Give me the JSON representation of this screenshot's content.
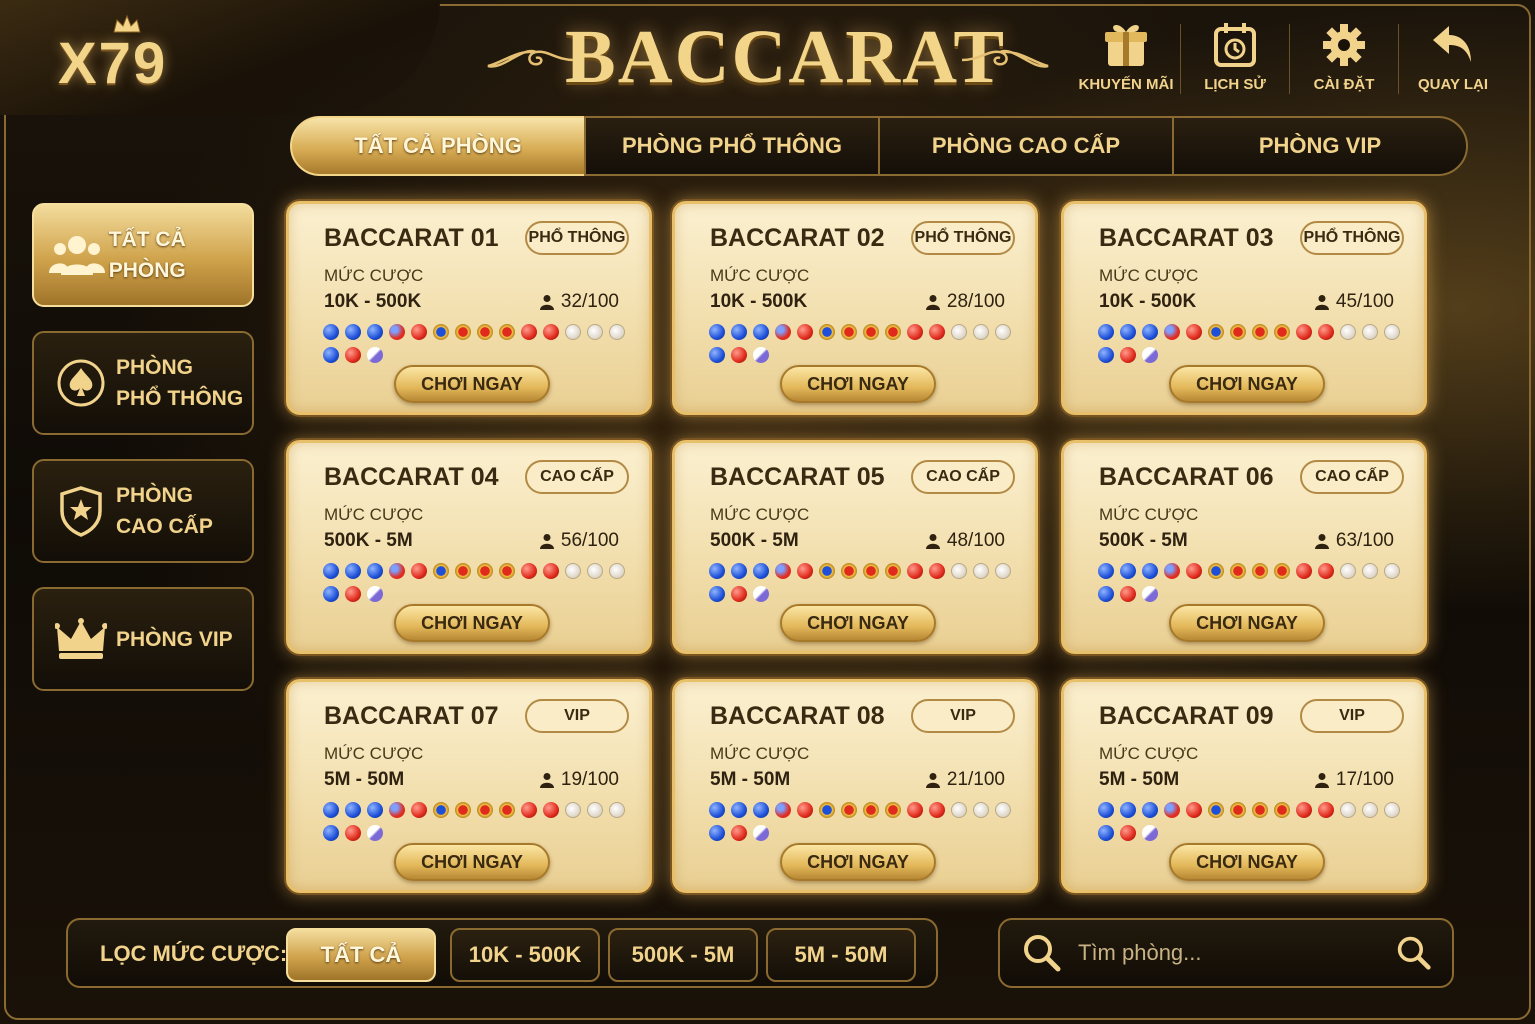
{
  "header": {
    "logo": "X79",
    "title": "BACCARAT",
    "actions": [
      {
        "label": "KHUYẾN MÃI",
        "icon": "gift-icon"
      },
      {
        "label": "LỊCH SỬ",
        "icon": "calendar-history-icon"
      },
      {
        "label": "CÀI ĐẶT",
        "icon": "gear-icon"
      },
      {
        "label": "QUAY LẠI",
        "icon": "back-arrow-icon"
      }
    ]
  },
  "tabs": [
    {
      "label": "TẤT CẢ PHÒNG",
      "active": true
    },
    {
      "label": "PHÒNG PHỔ THÔNG",
      "active": false
    },
    {
      "label": "PHÒNG CAO CẤP",
      "active": false
    },
    {
      "label": "PHÒNG VIP",
      "active": false
    }
  ],
  "sidebar": {
    "items": [
      {
        "label": "TẤT CẢ PHÒNG",
        "icon": "users-group-icon",
        "active": true
      },
      {
        "label_line1": "PHÒNG",
        "label_line2": "PHỔ THÔNG",
        "icon": "spade-icon",
        "active": false
      },
      {
        "label_line1": "PHÒNG",
        "label_line2": "CAO CẤP",
        "icon": "shield-star-icon",
        "active": false
      },
      {
        "label": "PHÒNG VIP",
        "icon": "crown-icon",
        "active": false
      }
    ]
  },
  "rooms": {
    "bet_label": "MỨC CƯỢC",
    "play_label": "CHƠI NGAY",
    "list": [
      {
        "name": "BACCARAT 01",
        "tier": "PHỔ THÔNG",
        "range": "10K - 500K",
        "players": "32/100"
      },
      {
        "name": "BACCARAT 02",
        "tier": "PHỔ THÔNG",
        "range": "10K - 500K",
        "players": "28/100"
      },
      {
        "name": "BACCARAT 03",
        "tier": "PHỔ THÔNG",
        "range": "10K - 500K",
        "players": "45/100"
      },
      {
        "name": "BACCARAT 04",
        "tier": "CAO CẤP",
        "range": "500K - 5M",
        "players": "56/100"
      },
      {
        "name": "BACCARAT 05",
        "tier": "CAO CẤP",
        "range": "500K - 5M",
        "players": "48/100"
      },
      {
        "name": "BACCARAT 06",
        "tier": "CAO CẤP",
        "range": "500K - 5M",
        "players": "63/100"
      },
      {
        "name": "BACCARAT 07",
        "tier": "VIP",
        "range": "5M - 50M",
        "players": "19/100"
      },
      {
        "name": "BACCARAT 08",
        "tier": "VIP",
        "range": "5M - 50M",
        "players": "21/100"
      },
      {
        "name": "BACCARAT 09",
        "tier": "VIP",
        "range": "5M - 50M",
        "players": "17/100"
      }
    ],
    "bead_rows": [
      [
        "B",
        "B",
        "B",
        "T",
        "P",
        "BR",
        "PR",
        "PR",
        "PR",
        "P",
        "P",
        "W",
        "W",
        "W"
      ],
      [
        "B",
        "P",
        "V"
      ]
    ]
  },
  "filter": {
    "label": "LỌC MỨC CƯỢC:",
    "options": [
      {
        "label": "TẤT CẢ",
        "active": true
      },
      {
        "label": "10K - 500K",
        "active": false
      },
      {
        "label": "500K - 5M",
        "active": false
      },
      {
        "label": "5M - 50M",
        "active": false
      }
    ]
  },
  "search": {
    "placeholder": "Tìm phòng..."
  },
  "colors": {
    "gold": "#f3d58a",
    "dark": "#140f08",
    "bead_banker": "#1d4fd8",
    "bead_player": "#e02a1c"
  }
}
